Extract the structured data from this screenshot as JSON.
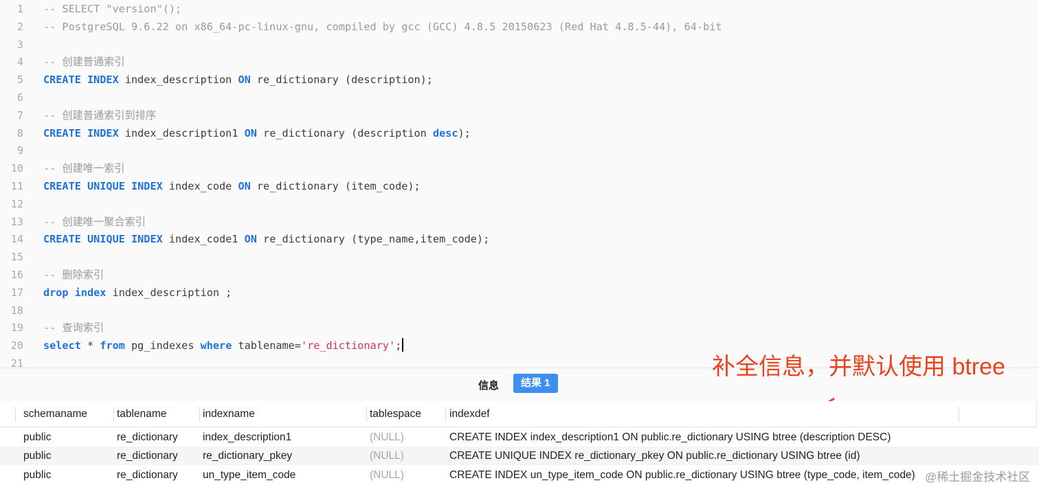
{
  "editor": {
    "lines": [
      {
        "n": "1",
        "tokens": [
          {
            "t": "c",
            "v": "-- SELECT \"version\"();"
          }
        ]
      },
      {
        "n": "2",
        "tokens": [
          {
            "t": "c",
            "v": "-- PostgreSQL 9.6.22 on x86_64-pc-linux-gnu, compiled by gcc (GCC) 4.8.5 20150623 (Red Hat 4.8.5-44), 64-bit"
          }
        ]
      },
      {
        "n": "3",
        "tokens": []
      },
      {
        "n": "4",
        "tokens": [
          {
            "t": "c",
            "v": "-- 创建普通索引"
          }
        ]
      },
      {
        "n": "5",
        "tokens": [
          {
            "t": "k",
            "v": "CREATE INDEX"
          },
          {
            "t": "p",
            "v": " index_description "
          },
          {
            "t": "k",
            "v": "ON"
          },
          {
            "t": "p",
            "v": " re_dictionary (description);"
          }
        ]
      },
      {
        "n": "6",
        "tokens": []
      },
      {
        "n": "7",
        "tokens": [
          {
            "t": "c",
            "v": "-- 创建普通索引到排序"
          }
        ]
      },
      {
        "n": "8",
        "tokens": [
          {
            "t": "k",
            "v": "CREATE INDEX"
          },
          {
            "t": "p",
            "v": " index_description1 "
          },
          {
            "t": "k",
            "v": "ON"
          },
          {
            "t": "p",
            "v": " re_dictionary (description "
          },
          {
            "t": "k",
            "v": "desc"
          },
          {
            "t": "p",
            "v": ");"
          }
        ]
      },
      {
        "n": "9",
        "tokens": []
      },
      {
        "n": "10",
        "tokens": [
          {
            "t": "c",
            "v": "-- 创建唯一索引"
          }
        ]
      },
      {
        "n": "11",
        "tokens": [
          {
            "t": "k",
            "v": "CREATE UNIQUE INDEX"
          },
          {
            "t": "p",
            "v": " index_code "
          },
          {
            "t": "k",
            "v": "ON"
          },
          {
            "t": "p",
            "v": " re_dictionary (item_code);"
          }
        ]
      },
      {
        "n": "12",
        "tokens": []
      },
      {
        "n": "13",
        "tokens": [
          {
            "t": "c",
            "v": "-- 创建唯一聚合索引"
          }
        ]
      },
      {
        "n": "14",
        "tokens": [
          {
            "t": "k",
            "v": "CREATE UNIQUE INDEX"
          },
          {
            "t": "p",
            "v": " index_code1 "
          },
          {
            "t": "k",
            "v": "ON"
          },
          {
            "t": "p",
            "v": " re_dictionary (type_name,item_code);"
          }
        ]
      },
      {
        "n": "15",
        "tokens": []
      },
      {
        "n": "16",
        "tokens": [
          {
            "t": "c",
            "v": "-- 删除索引"
          }
        ]
      },
      {
        "n": "17",
        "tokens": [
          {
            "t": "k",
            "v": "drop index"
          },
          {
            "t": "p",
            "v": " index_description ;"
          }
        ]
      },
      {
        "n": "18",
        "tokens": []
      },
      {
        "n": "19",
        "tokens": [
          {
            "t": "c",
            "v": "-- 查询索引"
          }
        ]
      },
      {
        "n": "20",
        "tokens": [
          {
            "t": "k",
            "v": "select"
          },
          {
            "t": "p",
            "v": " * "
          },
          {
            "t": "k",
            "v": "from"
          },
          {
            "t": "p",
            "v": " pg_indexes "
          },
          {
            "t": "k",
            "v": "where"
          },
          {
            "t": "p",
            "v": " tablename="
          },
          {
            "t": "s",
            "v": "'re_dictionary'"
          },
          {
            "t": "p",
            "v": ";"
          }
        ],
        "caret": true
      },
      {
        "n": "21",
        "tokens": []
      }
    ]
  },
  "tabs": {
    "info_label": "信息",
    "result_label": "结果 1"
  },
  "annotation": {
    "text": "补全信息，并默认使用 btree",
    "color": "#e8431f"
  },
  "grid": {
    "columns": [
      "schemaname",
      "tablename",
      "indexname",
      "tablespace",
      "indexdef"
    ],
    "rows": [
      [
        "public",
        "re_dictionary",
        "index_description1",
        "(NULL)",
        "CREATE INDEX index_description1 ON public.re_dictionary USING btree (description DESC)"
      ],
      [
        "public",
        "re_dictionary",
        "re_dictionary_pkey",
        "(NULL)",
        "CREATE UNIQUE INDEX re_dictionary_pkey ON public.re_dictionary USING btree (id)"
      ],
      [
        "public",
        "re_dictionary",
        "un_type_item_code",
        "(NULL)",
        "CREATE INDEX un_type_item_code ON public.re_dictionary USING btree (type_code, item_code)"
      ]
    ]
  },
  "watermark": "@稀土掘金技术社区",
  "colors": {
    "keyword": "#1f72d8",
    "comment": "#9a9a9a",
    "string": "#d2334a",
    "accent_tab": "#3d8ff0"
  }
}
